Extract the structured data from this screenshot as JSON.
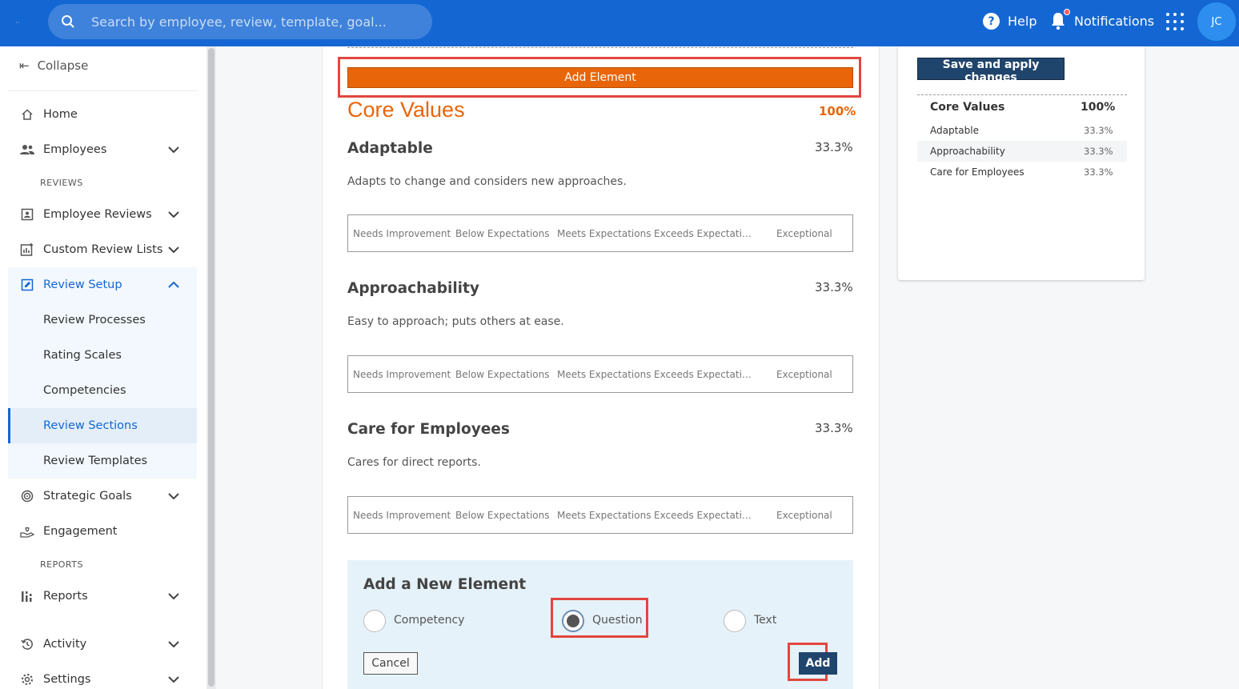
{
  "topbar": {
    "search_placeholder": "Search by employee, review, template, goal...",
    "help_label": "Help",
    "notifications_label": "Notifications",
    "avatar_initials": "JC"
  },
  "sidebar": {
    "collapse_label": "Collapse",
    "home": "Home",
    "employees": "Employees",
    "reviews_section": "REVIEWS",
    "employee_reviews": "Employee Reviews",
    "custom_review_lists": "Custom Review Lists",
    "review_setup": "Review Setup",
    "sub_items": [
      "Review Processes",
      "Rating Scales",
      "Competencies",
      "Review Sections",
      "Review Templates"
    ],
    "strategic_goals": "Strategic Goals",
    "engagement": "Engagement",
    "reports_section": "REPORTS",
    "reports": "Reports",
    "activity": "Activity",
    "settings": "Settings"
  },
  "main": {
    "add_element_label": "Add Element",
    "section_title": "Core Values",
    "section_pct": "100%",
    "competencies": [
      {
        "title": "Adaptable",
        "pct": "33.3%",
        "desc": "Adapts to change and considers new approaches."
      },
      {
        "title": "Approachability",
        "pct": "33.3%",
        "desc": "Easy to approach; puts others at ease."
      },
      {
        "title": "Care for Employees",
        "pct": "33.3%",
        "desc": "Cares for direct reports."
      }
    ],
    "scale_labels": [
      "Needs Improvement",
      "Below Expectations",
      "Meets Expectations",
      "Exceeds Expectati…",
      "Exceptional"
    ]
  },
  "new_element": {
    "title": "Add a New Element",
    "options": [
      "Competency",
      "Question",
      "Text"
    ],
    "selected": "Question",
    "cancel_label": "Cancel",
    "add_label": "Add"
  },
  "right_panel": {
    "save_label": "Save and apply changes",
    "heading": "Core Values",
    "heading_pct": "100%",
    "rows": [
      {
        "name": "Adaptable",
        "pct": "33.3%"
      },
      {
        "name": "Approachability",
        "pct": "33.3%"
      },
      {
        "name": "Care for Employees",
        "pct": "33.3%"
      }
    ]
  },
  "colors": {
    "topbar": "#1467d3",
    "accent_orange": "#e8650a",
    "highlight_red": "#e2463f",
    "navy_button": "#20456d"
  }
}
